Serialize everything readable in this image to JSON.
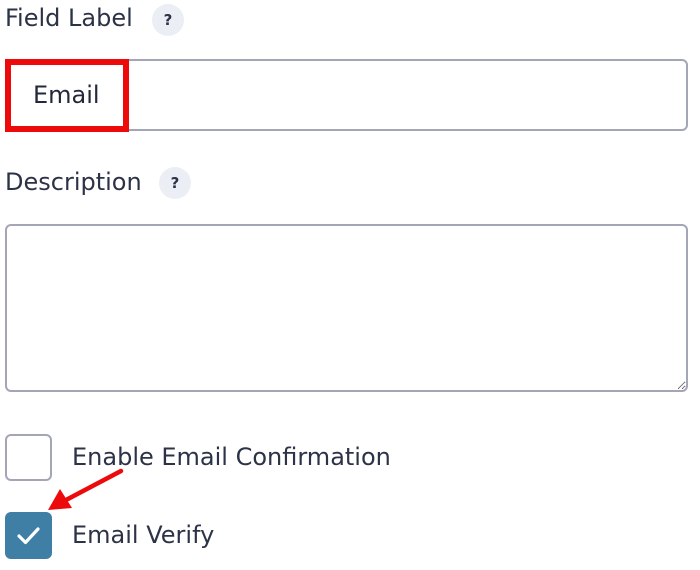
{
  "field_label": {
    "label": "Field Label",
    "help": "?",
    "value": "Email"
  },
  "description": {
    "label": "Description",
    "help": "?",
    "value": ""
  },
  "options": {
    "enable_confirmation": {
      "label": "Enable Email Confirmation",
      "checked": false
    },
    "email_verify": {
      "label": "Email Verify",
      "checked": true
    }
  },
  "colors": {
    "annotation": "#ec0a0a",
    "checkbox_checked": "#3f7fa6",
    "border": "#a3a6b6",
    "help_bg": "#eceef6"
  },
  "icons": {
    "help": "help-circle-icon",
    "check": "check-icon",
    "resize": "resize-handle-icon",
    "annotation": "red-arrow-annotation"
  }
}
